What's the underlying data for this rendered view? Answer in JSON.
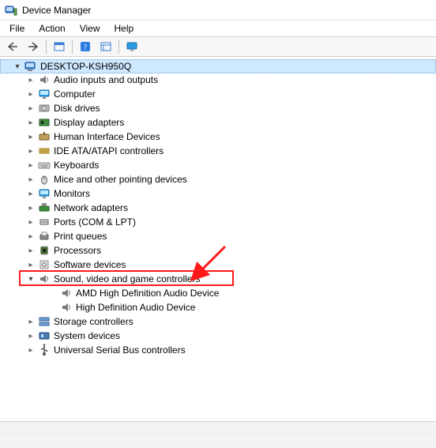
{
  "window": {
    "title": "Device Manager"
  },
  "menu": {
    "file": "File",
    "action": "Action",
    "view": "View",
    "help": "Help"
  },
  "toolbar_icons": {
    "back": "back-icon",
    "forward": "forward-icon",
    "show_hidden": "show-hidden-icon",
    "help": "help-icon",
    "properties": "properties-icon",
    "display": "display-icon"
  },
  "tree": {
    "root": {
      "label": "DESKTOP-KSH950Q",
      "icon": "computer-icon"
    },
    "categories": [
      {
        "label": "Audio inputs and outputs",
        "icon": "speaker-icon"
      },
      {
        "label": "Computer",
        "icon": "monitor-icon"
      },
      {
        "label": "Disk drives",
        "icon": "disk-icon"
      },
      {
        "label": "Display adapters",
        "icon": "display-adapter-icon"
      },
      {
        "label": "Human Interface Devices",
        "icon": "hid-icon"
      },
      {
        "label": "IDE ATA/ATAPI controllers",
        "icon": "ide-icon"
      },
      {
        "label": "Keyboards",
        "icon": "keyboard-icon"
      },
      {
        "label": "Mice and other pointing devices",
        "icon": "mouse-icon"
      },
      {
        "label": "Monitors",
        "icon": "monitor-icon"
      },
      {
        "label": "Network adapters",
        "icon": "network-icon"
      },
      {
        "label": "Ports (COM & LPT)",
        "icon": "port-icon"
      },
      {
        "label": "Print queues",
        "icon": "printer-icon"
      },
      {
        "label": "Processors",
        "icon": "cpu-icon"
      },
      {
        "label": "Software devices",
        "icon": "software-icon"
      },
      {
        "label": "Sound, video and game controllers",
        "icon": "speaker-icon",
        "expanded": true,
        "highlighted": true,
        "children": [
          {
            "label": "AMD High Definition Audio Device",
            "icon": "speaker-icon"
          },
          {
            "label": "High Definition Audio Device",
            "icon": "speaker-icon"
          }
        ]
      },
      {
        "label": "Storage controllers",
        "icon": "storage-icon"
      },
      {
        "label": "System devices",
        "icon": "system-icon"
      },
      {
        "label": "Universal Serial Bus controllers",
        "icon": "usb-icon"
      }
    ]
  },
  "annotation": {
    "highlight_color": "#ff1a1a",
    "arrow_color": "#ff1a1a"
  }
}
